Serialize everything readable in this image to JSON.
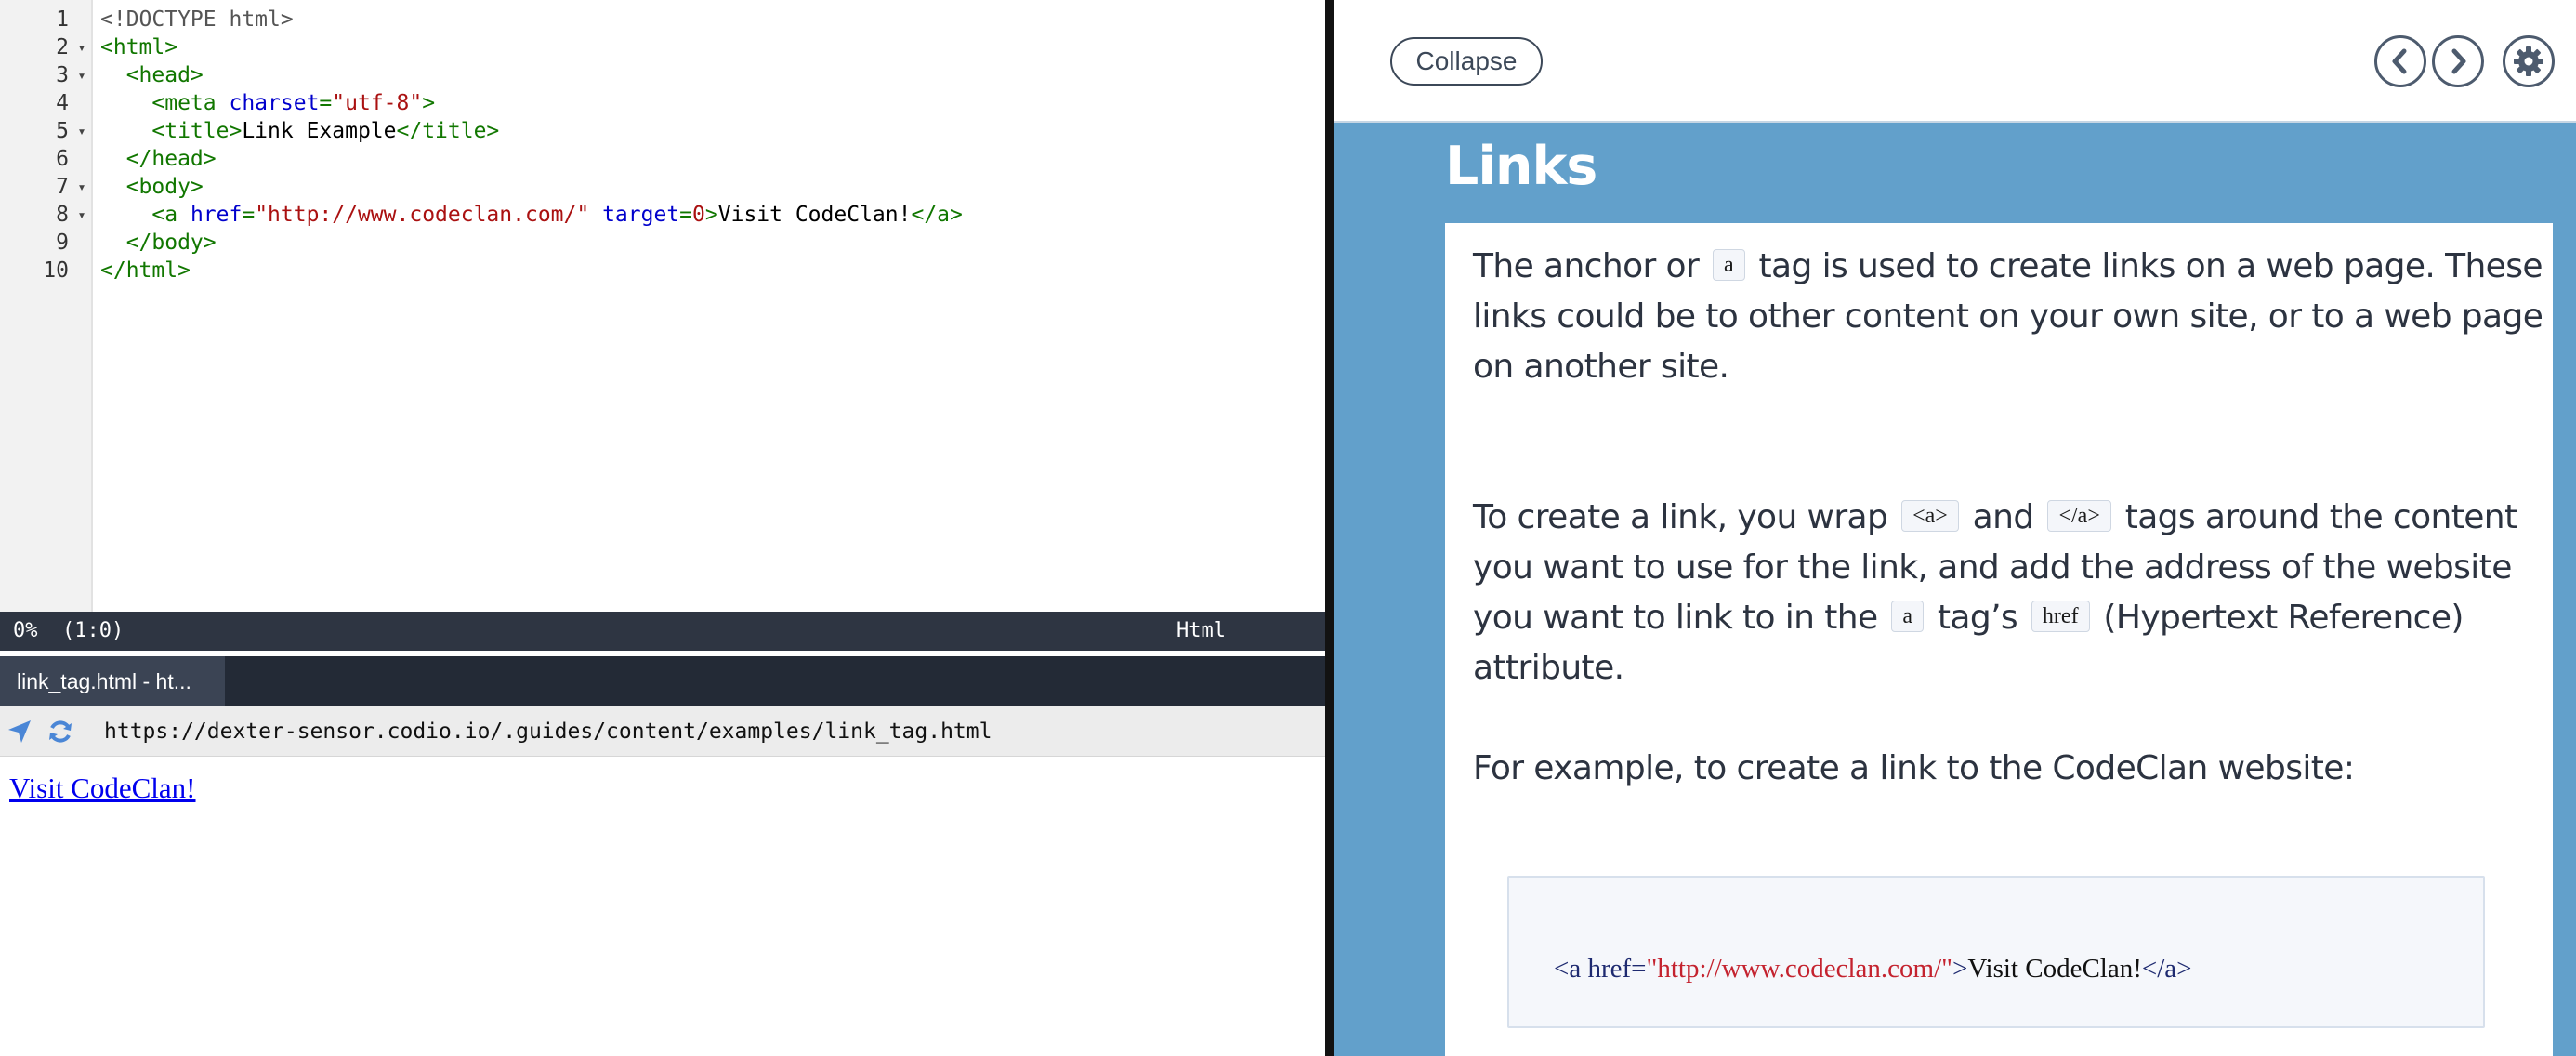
{
  "editor": {
    "lines": [
      {
        "num": "1",
        "fold": "",
        "parts": [
          {
            "text": "<!DOCTYPE html>",
            "cls": "t-meta"
          }
        ]
      },
      {
        "num": "2",
        "fold": "▾",
        "parts": [
          {
            "text": "<html>",
            "cls": "t-tag"
          }
        ]
      },
      {
        "num": "3",
        "fold": "▾",
        "parts": [
          {
            "text": "  <head>",
            "cls": "t-tag"
          }
        ]
      },
      {
        "num": "4",
        "fold": "",
        "parts": [
          {
            "text": "    <meta ",
            "cls": "t-tag"
          },
          {
            "text": "charset",
            "cls": "t-attr"
          },
          {
            "text": "=",
            "cls": "t-tag"
          },
          {
            "text": "\"utf-8\"",
            "cls": "t-str"
          },
          {
            "text": ">",
            "cls": "t-tag"
          }
        ]
      },
      {
        "num": "5",
        "fold": "▾",
        "parts": [
          {
            "text": "    <title>",
            "cls": "t-tag"
          },
          {
            "text": "Link Example",
            "cls": ""
          },
          {
            "text": "</title>",
            "cls": "t-tag"
          }
        ]
      },
      {
        "num": "6",
        "fold": "",
        "parts": [
          {
            "text": "  </head>",
            "cls": "t-tag"
          }
        ]
      },
      {
        "num": "7",
        "fold": "▾",
        "parts": [
          {
            "text": "  <body>",
            "cls": "t-tag"
          }
        ]
      },
      {
        "num": "8",
        "fold": "▾",
        "parts": [
          {
            "text": "    <a ",
            "cls": "t-tag"
          },
          {
            "text": "href",
            "cls": "t-attr"
          },
          {
            "text": "=",
            "cls": "t-tag"
          },
          {
            "text": "\"http://www.codeclan.com/\"",
            "cls": "t-str"
          },
          {
            "text": " ",
            "cls": ""
          },
          {
            "text": "target",
            "cls": "t-attr"
          },
          {
            "text": "=",
            "cls": "t-tag"
          },
          {
            "text": "0",
            "cls": "t-str"
          },
          {
            "text": ">",
            "cls": "t-tag"
          },
          {
            "text": "Visit CodeClan!",
            "cls": ""
          },
          {
            "text": "</a>",
            "cls": "t-tag"
          }
        ]
      },
      {
        "num": "9",
        "fold": "",
        "parts": [
          {
            "text": "  </body>",
            "cls": "t-tag"
          }
        ]
      },
      {
        "num": "10",
        "fold": "",
        "parts": [
          {
            "text": "</html>",
            "cls": "t-tag"
          }
        ]
      }
    ]
  },
  "status": {
    "position": "0%  (1:0)",
    "mode": "Html"
  },
  "preview_tab": {
    "label": "link_tag.html - ht..."
  },
  "browser": {
    "url": "https://dexter-sensor.codio.io/.guides/content/examples/link_tag.html",
    "link_text": "Visit CodeClan!",
    "nav_icon": "navigate-arrow-icon",
    "refresh_icon": "refresh-icon"
  },
  "guide": {
    "collapse_label": "Collapse",
    "title": "Links",
    "p1": [
      {
        "t": "The anchor or "
      },
      {
        "code": "a"
      },
      {
        "t": " tag is used to create links on a web page. These links could be to other content on your own site, or to a web page on another site."
      }
    ],
    "p2": [
      {
        "t": "To create a link, you wrap "
      },
      {
        "code": "<a>"
      },
      {
        "t": " and "
      },
      {
        "code": "</a>"
      },
      {
        "t": " tags around the content you want to use for the link, and add the address of the website you want to link to in the "
      },
      {
        "code": "a"
      },
      {
        "t": " tag’s "
      },
      {
        "code": "href"
      },
      {
        "t": " (Hypertext Reference) attribute."
      }
    ],
    "p3": "For example, to create a link to the CodeClan website:",
    "example": {
      "open": "<a href=",
      "url": "\"http://www.codeclan.com/\"",
      "close_open": ">",
      "text": "Visit CodeClan!",
      "close": "</a>"
    }
  },
  "colors": {
    "guide_background": "#62a0cb",
    "statusbar": "#2e3542",
    "link": "#0000ee"
  }
}
